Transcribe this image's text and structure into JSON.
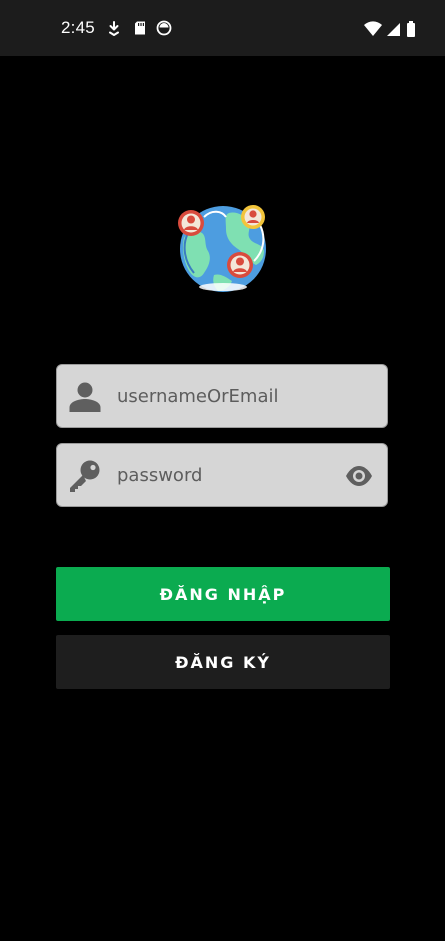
{
  "status_bar": {
    "time": "2:45",
    "icons_left": [
      "download-icon",
      "sd-card-icon",
      "app-notification-icon"
    ],
    "icons_right": [
      "wifi-icon",
      "cell-signal-icon",
      "battery-icon"
    ]
  },
  "logo": {
    "icon": "globe-people-network-icon"
  },
  "form": {
    "username_field": {
      "placeholder": "usernameOrEmail",
      "icon": "person-icon"
    },
    "password_field": {
      "placeholder": "password",
      "icon": "key-icon",
      "toggle_icon": "eye-icon"
    }
  },
  "buttons": {
    "login_label": "ĐĂNG NHẬP",
    "register_label": "ĐĂNG KÝ"
  },
  "colors": {
    "background": "#000000",
    "status_bar": "#1c1c1c",
    "field_background": "#d6d6d6",
    "login_button": "#0bab50",
    "register_button": "#1e1e1e"
  }
}
